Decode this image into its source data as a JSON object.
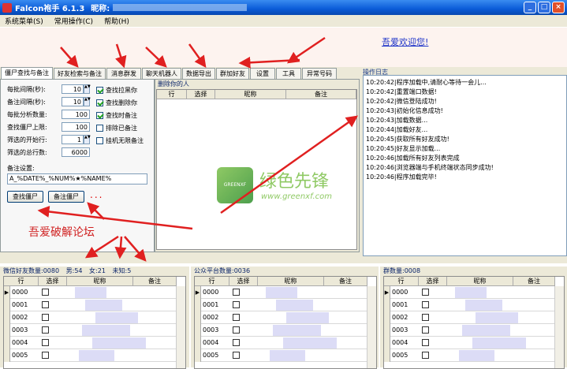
{
  "window": {
    "title": "Falcon袍手 6.1.3",
    "nick_label": "昵称:"
  },
  "menu": [
    "系统菜单(S)",
    "常用操作(C)",
    "帮助(H)"
  ],
  "welcome": "吾爱欢迎您!",
  "tabs": [
    "僵尸查找与备注",
    "好友检索与备注",
    "消息群发",
    "聊天机器人",
    "数据导出",
    "群加好友",
    "设置",
    "工具",
    "异常号码"
  ],
  "settings": {
    "rows": [
      {
        "label": "每批间隔(秒):",
        "value": "10"
      },
      {
        "label": "备注间隔(秒):",
        "value": "10"
      },
      {
        "label": "每批分析数量:",
        "value": "100"
      },
      {
        "label": "查找僵尸上限:",
        "value": "100"
      },
      {
        "label": "筛选的开始行:",
        "value": "1"
      },
      {
        "label": "筛选的总行数:",
        "value": "6000"
      }
    ],
    "checks": [
      {
        "label": "查找拉黑你",
        "checked": true
      },
      {
        "label": "查找删除你",
        "checked": true
      },
      {
        "label": "查找时备注",
        "checked": true
      },
      {
        "label": "排除已备注",
        "checked": false
      },
      {
        "label": "挂机无限备注",
        "checked": false
      }
    ],
    "remark_label": "备注设置:",
    "remark_value": "A_%DATE%_%NUM%★%NAME%",
    "find_button": "查找僵尸",
    "remark_button": "备注僵尸",
    "dots": "...",
    "forum_text": "吾爱破解论坛"
  },
  "deleted": {
    "title": "删除你的人",
    "cols": [
      "行",
      "选择",
      "昵称",
      "备注"
    ]
  },
  "log": {
    "title": "操作日志",
    "lines": [
      "10:20:42|程序加载中,请耐心等待一会儿...",
      "10:20:42|重置端口数据!",
      "10:20:42|微信登陆成功!",
      "10:20:43|初始化信息成功!",
      "10:20:43|加载数据...",
      "10:20:44|加载好友...",
      "10:20:45|获取所有好友成功!",
      "10:20:45|好友显示加载...",
      "10:20:46|加载所有好友列表完成",
      "10:20:46|浏览器端与手机终端状态同步成功!",
      "10:20:46|程序加载完毕!"
    ]
  },
  "watermark": {
    "main": "绿色先锋",
    "url": "www.greenxf.com",
    "badge": "GREENXF"
  },
  "friends": {
    "label": "微信好友数量:",
    "count": "0080",
    "male_label": "男:",
    "male": "54",
    "female_label": "女:",
    "female": "21",
    "unknown_label": "未知:",
    "unknown": "5",
    "cols": [
      "行",
      "选择",
      "昵称",
      "备注"
    ],
    "rows": [
      "0000",
      "0001",
      "0002",
      "0003",
      "0004",
      "0005"
    ]
  },
  "public": {
    "label": "公众平台数量:",
    "count": "0036",
    "cols": [
      "行",
      "选择",
      "昵称",
      "备注"
    ],
    "rows": [
      "0000",
      "0001",
      "0002",
      "0003",
      "0004",
      "0005"
    ]
  },
  "groups": {
    "label": "群数量:",
    "count": "0008",
    "cols": [
      "行",
      "选择",
      "昵称",
      "备注"
    ],
    "rows": [
      "0000",
      "0001",
      "0002",
      "0003",
      "0004",
      "0005"
    ]
  },
  "colors": {
    "accent_red": "#e02020",
    "link_blue": "#2036c9"
  }
}
